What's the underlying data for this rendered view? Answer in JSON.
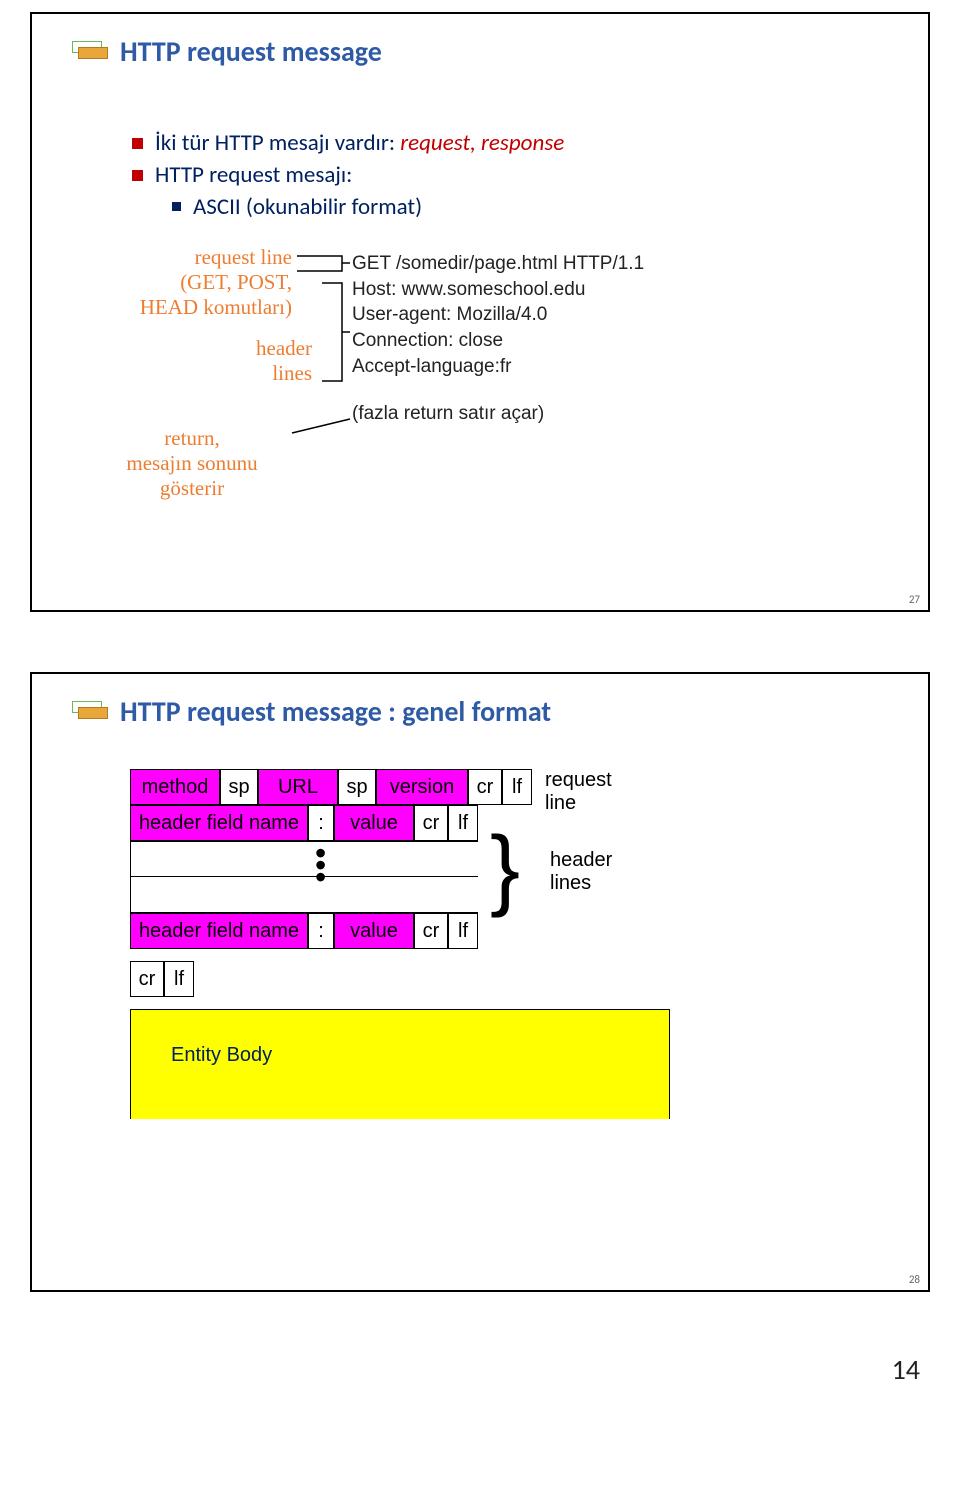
{
  "slide1": {
    "title": "HTTP request message",
    "bullets": {
      "line1a": "İki tür HTTP mesajı vardır: ",
      "line1b": "request, response",
      "line2": "HTTP request mesajı:",
      "line3": "ASCII (okunabilir format)"
    },
    "annotations": {
      "request_line_1": "request line",
      "request_line_2": "(GET, POST,",
      "request_line_3": "HEAD komutları)",
      "header_1": "header",
      "header_2": "lines",
      "return_1": "return,",
      "return_2": "mesajın sonunu",
      "return_3": "gösterir"
    },
    "message": {
      "l1": "GET /somedir/page.html HTTP/1.1",
      "l2": "Host: www.someschool.edu",
      "l3": "User-agent: Mozilla/4.0",
      "l4": "Connection: close",
      "l5": "Accept-language:fr",
      "l6": "(fazla return satır açar)"
    },
    "page_num": "27"
  },
  "slide2": {
    "title": "HTTP request message : genel format",
    "labels": {
      "method": "method",
      "sp": "sp",
      "url": "URL",
      "version": "version",
      "cr": "cr",
      "lf": "lf",
      "request_line": "request line",
      "header_field": "header field name",
      "colon": ":",
      "value": "value",
      "header_lines": "header lines",
      "entity_body": "Entity Body"
    },
    "page_num": "28"
  },
  "footer_page": "14"
}
